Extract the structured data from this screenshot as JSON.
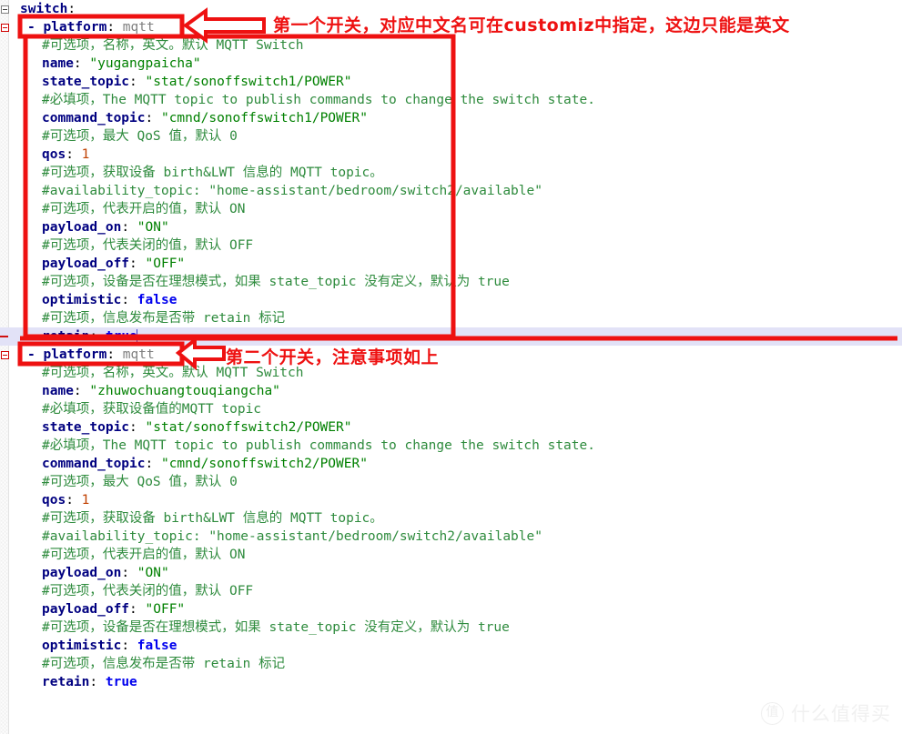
{
  "editor": {
    "root_key": "switch:",
    "current_line_index": 17,
    "blocks": [
      {
        "id": "switch-block-1",
        "annotation": "第一个开关，对应中文名可在customiz中指定，这边只能是英文",
        "header": {
          "dash": "-",
          "key": "platform",
          "value": "mqtt"
        },
        "lines": [
          {
            "type": "comment",
            "text": "#可选项，名称，英文。默认 MQTT Switch"
          },
          {
            "type": "pair",
            "key": "name",
            "value": "\"yugangpaicha\"",
            "vclass": "str"
          },
          {
            "type": "pair",
            "key": "state_topic",
            "value": "\"stat/sonoffswitch1/POWER\"",
            "vclass": "str"
          },
          {
            "type": "comment",
            "text": "#必填项，The MQTT topic to publish commands to change the switch state."
          },
          {
            "type": "pair",
            "key": "command_topic",
            "value": "\"cmnd/sonoffswitch1/POWER\"",
            "vclass": "str"
          },
          {
            "type": "comment",
            "text": "#可选项，最大 QoS 值，默认 0"
          },
          {
            "type": "pair",
            "key": "qos",
            "value": "1",
            "vclass": "num"
          },
          {
            "type": "comment",
            "text": "#可选项，获取设备 birth&LWT 信息的 MQTT topic。"
          },
          {
            "type": "comment",
            "text": "#availability_topic: \"home-assistant/bedroom/switch2/available\""
          },
          {
            "type": "comment",
            "text": "#可选项，代表开启的值，默认 ON"
          },
          {
            "type": "pair",
            "key": "payload_on",
            "value": "\"ON\"",
            "vclass": "str"
          },
          {
            "type": "comment",
            "text": "#可选项，代表关闭的值，默认 OFF"
          },
          {
            "type": "pair",
            "key": "payload_off",
            "value": "\"OFF\"",
            "vclass": "str"
          },
          {
            "type": "comment",
            "text": "#可选项，设备是否在理想模式，如果 state_topic 没有定义，默认为 true"
          },
          {
            "type": "pair",
            "key": "optimistic",
            "value": "false",
            "vclass": "bool"
          },
          {
            "type": "comment",
            "text": "#可选项，信息发布是否带 retain 标记"
          },
          {
            "type": "pair",
            "key": "retain",
            "value": "true",
            "vclass": "bool",
            "current": true
          }
        ]
      },
      {
        "id": "switch-block-2",
        "annotation": "第二个开关，注意事项如上",
        "header": {
          "dash": "-",
          "key": "platform",
          "value": "mqtt"
        },
        "lines": [
          {
            "type": "comment",
            "text": "#可选项，名称，英文。默认 MQTT Switch"
          },
          {
            "type": "pair",
            "key": "name",
            "value": "\"zhuwochuangtouqiangcha\"",
            "vclass": "str"
          },
          {
            "type": "comment",
            "text": "#必填项，获取设备值的MQTT topic"
          },
          {
            "type": "pair",
            "key": "state_topic",
            "value": "\"stat/sonoffswitch2/POWER\"",
            "vclass": "str"
          },
          {
            "type": "comment",
            "text": "#必填项，The MQTT topic to publish commands to change the switch state."
          },
          {
            "type": "pair",
            "key": "command_topic",
            "value": "\"cmnd/sonoffswitch2/POWER\"",
            "vclass": "str"
          },
          {
            "type": "comment",
            "text": "#可选项，最大 QoS 值，默认 0"
          },
          {
            "type": "pair",
            "key": "qos",
            "value": "1",
            "vclass": "num"
          },
          {
            "type": "comment",
            "text": "#可选项，获取设备 birth&LWT 信息的 MQTT topic。"
          },
          {
            "type": "comment",
            "text": "#availability_topic: \"home-assistant/bedroom/switch2/available\""
          },
          {
            "type": "comment",
            "text": "#可选项，代表开启的值，默认 ON"
          },
          {
            "type": "pair",
            "key": "payload_on",
            "value": "\"ON\"",
            "vclass": "str"
          },
          {
            "type": "comment",
            "text": "#可选项，代表关闭的值，默认 OFF"
          },
          {
            "type": "pair",
            "key": "payload_off",
            "value": "\"OFF\"",
            "vclass": "str"
          },
          {
            "type": "comment",
            "text": "#可选项，设备是否在理想模式，如果 state_topic 没有定义，默认为 true"
          },
          {
            "type": "pair",
            "key": "optimistic",
            "value": "false",
            "vclass": "bool"
          },
          {
            "type": "comment",
            "text": "#可选项，信息发布是否带 retain 标记"
          },
          {
            "type": "pair",
            "key": "retain",
            "value": "true",
            "vclass": "bool"
          }
        ]
      }
    ]
  },
  "colors": {
    "annotation_red": "#ee1111",
    "box_red": "#ee1111",
    "key_navy": "#000080",
    "string_green": "#008000",
    "comment_green": "#2e8b3d",
    "bool_blue": "#0000ee",
    "number_orange": "#c04000",
    "current_line": "#e2e2f7"
  },
  "watermark": {
    "badge": "值",
    "text": "什么值得买"
  }
}
